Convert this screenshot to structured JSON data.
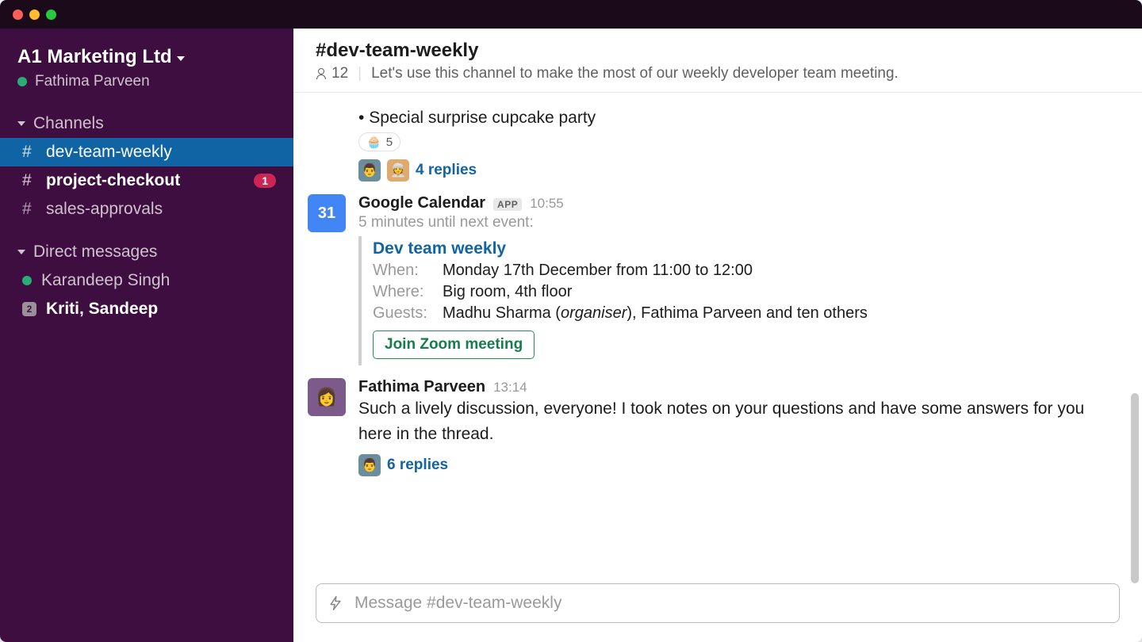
{
  "workspace": {
    "name": "A1 Marketing Ltd",
    "current_user": "Fathima Parveen"
  },
  "sidebar": {
    "sections": {
      "channels_label": "Channels",
      "dms_label": "Direct messages"
    },
    "channels": [
      {
        "name": "dev-team-weekly",
        "active": true,
        "unread": false,
        "badge": null
      },
      {
        "name": "project-checkout",
        "active": false,
        "unread": true,
        "badge": "1"
      },
      {
        "name": "sales-approvals",
        "active": false,
        "unread": false,
        "badge": null
      }
    ],
    "dms": [
      {
        "label": "Karandeep Singh",
        "presence": "active",
        "unread": false,
        "count": null
      },
      {
        "label": "Kriti, Sandeep",
        "presence": "group",
        "unread": true,
        "count": "2"
      }
    ]
  },
  "channel_header": {
    "name": "#dev-team-weekly",
    "member_count": "12",
    "topic": "Let's use this channel to make the most of our weekly developer team meeting."
  },
  "messages": {
    "prev_tail": {
      "bullet_text": "Special surprise cupcake party",
      "reaction_emoji": "🧁",
      "reaction_count": "5",
      "replies_label": "4 replies"
    },
    "calendar": {
      "sender": "Google Calendar",
      "app_badge": "APP",
      "time": "10:55",
      "avatar_text": "31",
      "preface": "5 minutes until next event:",
      "event_title": "Dev team weekly",
      "when_label": "When:",
      "when_value": "Monday 17th December from 11:00 to 12:00",
      "where_label": "Where:",
      "where_value": "Big room, 4th floor",
      "guests_label": "Guests:",
      "guests_value_pre": "Madhu Sharma (",
      "guests_value_em": "organiser",
      "guests_value_post": "), Fathima Parveen and ten others",
      "join_button": "Join Zoom meeting"
    },
    "fathima": {
      "sender": "Fathima Parveen",
      "time": "13:14",
      "text": "Such a lively discussion, everyone! I took notes on your questions and have some answers for you here in the thread.",
      "replies_label": "6 replies"
    }
  },
  "composer": {
    "placeholder": "Message #dev-team-weekly"
  }
}
